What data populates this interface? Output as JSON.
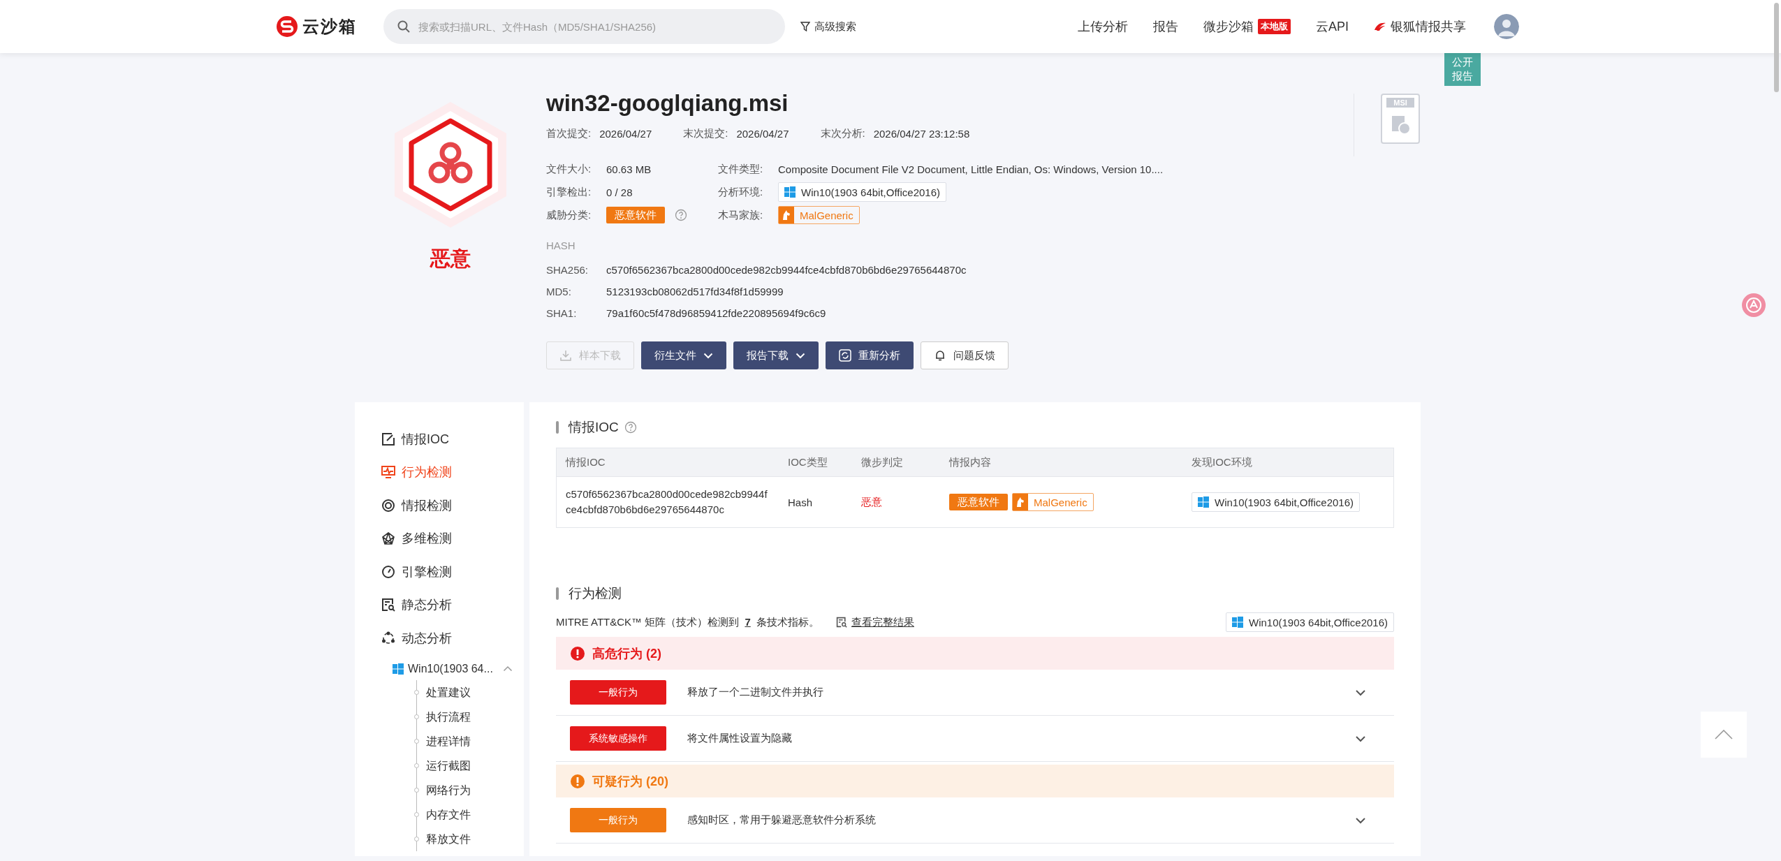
{
  "brand": {
    "name": "云沙箱"
  },
  "search": {
    "placeholder": "搜索或扫描URL、文件Hash（MD5/SHA1/SHA256)"
  },
  "advanced_search": "高级搜索",
  "nav": [
    {
      "label": "上传分析"
    },
    {
      "label": "报告"
    },
    {
      "label": "微步沙箱",
      "badge": "本地版"
    },
    {
      "label": "云API"
    },
    {
      "label": "银狐情报共享",
      "kind": "fox"
    }
  ],
  "public_report": "公开报告",
  "verdict": {
    "label": "恶意"
  },
  "file": {
    "name": "win32-googlqiang.msi",
    "type_badge": "MSI",
    "dates": [
      {
        "label": "首次提交:",
        "value": "2026/04/27"
      },
      {
        "label": "末次提交:",
        "value": "2026/04/27"
      },
      {
        "label": "末次分析:",
        "value": "2026/04/27 23:12:58"
      }
    ],
    "info": [
      {
        "label": "文件大小:",
        "value": "60.63 MB",
        "kind": "text"
      },
      {
        "label": "文件类型:",
        "value": "Composite Document File V2 Document, Little Endian, Os: Windows, Version 10....",
        "kind": "text"
      },
      {
        "label": "引擎检出:",
        "value": "0 / 28",
        "kind": "text"
      },
      {
        "label": "分析环境:",
        "value": "Win10(1903 64bit,Office2016)",
        "kind": "env"
      },
      {
        "label": "威胁分类:",
        "value": "恶意软件",
        "kind": "tag"
      },
      {
        "label": "木马家族:",
        "value": "MalGeneric",
        "kind": "family"
      }
    ],
    "hash_title": "HASH",
    "hashes": [
      {
        "label": "SHA256:",
        "value": "c570f6562367bca2800d00cede982cb9944fce4cbfd870b6bd6e29765644870c"
      },
      {
        "label": "MD5:",
        "value": "5123193cb08062d517fd34f8f1d59999"
      },
      {
        "label": "SHA1:",
        "value": "79a1f60c5f478d96859412fde220895694f9c6c9"
      }
    ]
  },
  "actions": [
    {
      "label": "样本下载",
      "kind": "download",
      "disabled": true
    },
    {
      "label": "衍生文件",
      "kind": "menu",
      "disabled": false
    },
    {
      "label": "报告下载",
      "kind": "menu",
      "disabled": false
    },
    {
      "label": "重新分析",
      "kind": "refresh",
      "disabled": false
    },
    {
      "label": "问题反馈",
      "kind": "feedback",
      "disabled": false
    }
  ],
  "sidebar": {
    "items": [
      {
        "label": "情报IOC",
        "selected": false
      },
      {
        "label": "行为检测",
        "selected": true
      },
      {
        "label": "情报检测",
        "selected": false
      },
      {
        "label": "多维检测",
        "selected": false
      },
      {
        "label": "引擎检测",
        "selected": false
      },
      {
        "label": "静态分析",
        "selected": false
      },
      {
        "label": "动态分析",
        "selected": false,
        "children": [
          {
            "label": "Win10(1903 64...",
            "expanded": true,
            "children": [
              {
                "label": "处置建议"
              },
              {
                "label": "执行流程"
              },
              {
                "label": "进程详情"
              },
              {
                "label": "运行截图"
              },
              {
                "label": "网络行为"
              },
              {
                "label": "内存文件"
              },
              {
                "label": "释放文件"
              }
            ]
          }
        ]
      }
    ]
  },
  "ioc": {
    "title": "情报IOC",
    "columns": [
      "情报IOC",
      "IOC类型",
      "微步判定",
      "情报内容",
      "发现IOC环境"
    ],
    "rows": [
      {
        "ioc": "c570f6562367bca2800d00cede982cb9944fce4cbfd870b6bd6e29765644870c",
        "type": "Hash",
        "verdict": "恶意",
        "tags": [
          {
            "label": "恶意软件",
            "kind": "tag"
          },
          {
            "label": "MalGeneric",
            "kind": "family"
          }
        ],
        "env": "Win10(1903 64bit,Office2016)"
      }
    ]
  },
  "behavior": {
    "title": "行为检测",
    "summary": "MITRE ATT&CK™ 矩阵（技术）检测到 **7** 条技术指标。",
    "link": "查看完整结果",
    "env": "Win10(1903 64bit,Office2016)",
    "groups": [
      {
        "title": "高危行为 (2)",
        "kind": "high",
        "rows": [
          {
            "tag": "一般行为",
            "text": "释放了一个二进制文件并执行"
          },
          {
            "tag": "系统敏感操作",
            "text": "将文件属性设置为隐藏"
          }
        ]
      },
      {
        "title": "可疑行为 (20)",
        "kind": "suspicious",
        "rows": [
          {
            "tag": "一般行为",
            "text": "感知时区，常用于躲避恶意软件分析系统"
          }
        ]
      }
    ]
  }
}
